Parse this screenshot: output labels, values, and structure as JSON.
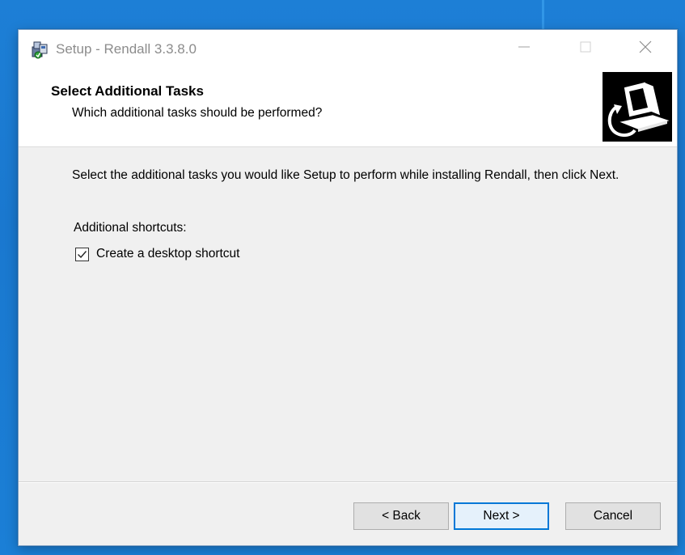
{
  "window": {
    "title": "Setup - Rendall 3.3.8.0",
    "icons": {
      "app": "setup-app-icon",
      "minimize": "minimize-icon",
      "maximize": "maximize-icon",
      "close": "close-icon"
    }
  },
  "header": {
    "title": "Select Additional Tasks",
    "subtitle": "Which additional tasks should be performed?",
    "image": "computer-install-icon"
  },
  "content": {
    "instructions": "Select the additional tasks you would like Setup to perform while installing Rendall, then click Next.",
    "group_label": "Additional shortcuts:",
    "tasks": [
      {
        "label": "Create a desktop shortcut",
        "checked": true
      }
    ]
  },
  "buttons": {
    "back": "< Back",
    "next": "Next >",
    "cancel": "Cancel"
  },
  "colors": {
    "desktop": "#1a78cf",
    "dialog": "#f0f0f0",
    "header": "#ffffff",
    "default_button_border": "#0078d7"
  }
}
